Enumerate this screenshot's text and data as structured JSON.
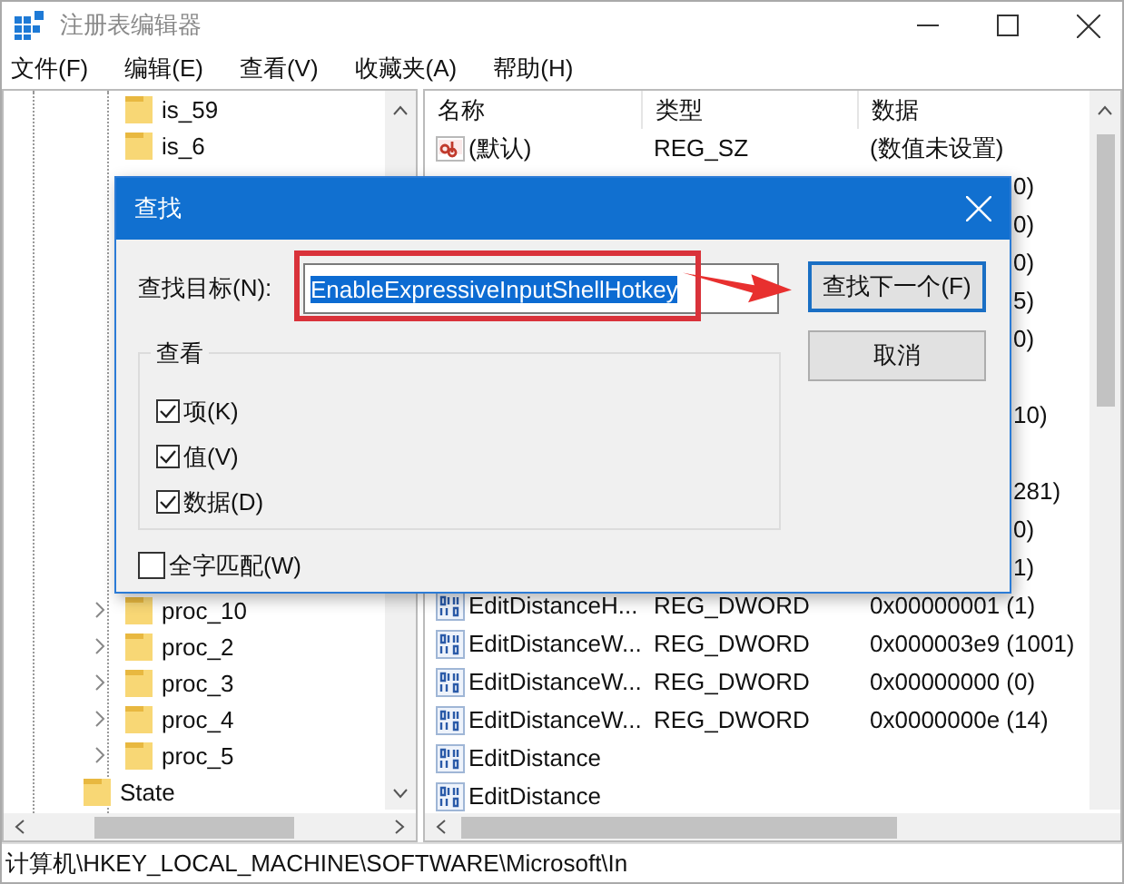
{
  "window": {
    "title": "注册表编辑器"
  },
  "menu": [
    "文件(F)",
    "编辑(E)",
    "查看(V)",
    "收藏夹(A)",
    "帮助(H)"
  ],
  "tree": {
    "items_above": [
      {
        "label": "is_59",
        "expandable": false
      },
      {
        "label": "is_6",
        "expandable": false
      }
    ],
    "items_below": [
      {
        "label": "proc_10",
        "expandable": true
      },
      {
        "label": "proc_2",
        "expandable": true
      },
      {
        "label": "proc_3",
        "expandable": true
      },
      {
        "label": "proc_4",
        "expandable": true
      },
      {
        "label": "proc_5",
        "expandable": true
      }
    ],
    "next_key": {
      "label": "State"
    }
  },
  "table": {
    "columns": [
      "名称",
      "类型",
      "数据"
    ],
    "rows": [
      {
        "kind": "string",
        "name": "(默认)",
        "type": "REG_SZ",
        "data": "(数值未设置)"
      },
      {
        "data": "0)"
      },
      {
        "data": "0)"
      },
      {
        "data": "0)"
      },
      {
        "data": "5)"
      },
      {
        "data": "0)"
      },
      {},
      {
        "data": "10)"
      },
      {},
      {
        "data": "281)"
      },
      {
        "data": "0)"
      },
      {
        "data": "1)"
      },
      {
        "kind": "dword",
        "name": "EditDistanceH...",
        "type": "REG_DWORD",
        "data": "0x00000001 (1)"
      },
      {
        "kind": "dword",
        "name": "EditDistanceW...",
        "type": "REG_DWORD",
        "data": "0x000003e9 (1001)"
      },
      {
        "kind": "dword",
        "name": "EditDistanceW...",
        "type": "REG_DWORD",
        "data": "0x00000000 (0)"
      },
      {
        "kind": "dword",
        "name": "EditDistanceW...",
        "type": "REG_DWORD",
        "data": "0x0000000e (14)"
      },
      {
        "kind": "dword",
        "name": "EditDistance"
      },
      {
        "kind": "dword",
        "name": "EditDistance"
      }
    ]
  },
  "dialog": {
    "title": "查找",
    "find_label": "查找目标(N):",
    "find_value": "EnableExpressiveInputShellHotkey",
    "value_selected": true,
    "buttons": [
      {
        "label": "查找下一个(F)",
        "default": true
      },
      {
        "label": "取消",
        "default": false
      }
    ],
    "look_in": {
      "title": "查看",
      "options": [
        {
          "label": "项(K)",
          "checked": true
        },
        {
          "label": "值(V)",
          "checked": true
        },
        {
          "label": "数据(D)",
          "checked": true
        }
      ]
    },
    "match_whole": {
      "label": "全字匹配(W)",
      "checked": false
    }
  },
  "status_bar": "计算机\\HKEY_LOCAL_MACHINE\\SOFTWARE\\Microsoft\\In"
}
